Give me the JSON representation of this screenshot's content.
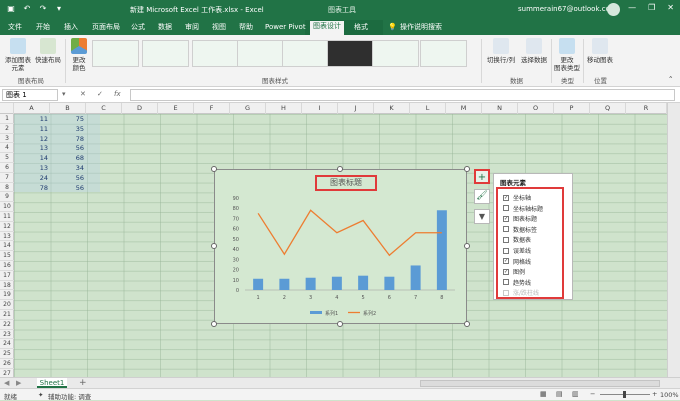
{
  "titlebar": {
    "document_title": "新建 Microsoft Excel 工作表.xlsx - Excel",
    "context_title": "图表工具",
    "account": "summerain67@outlook.com",
    "controls": [
      "—",
      "❐",
      "✕"
    ]
  },
  "tabs": [
    "文件",
    "开始",
    "插入",
    "页面布局",
    "公式",
    "数据",
    "审阅",
    "视图",
    "帮助",
    "Power Pivot",
    "图表设计",
    "格式"
  ],
  "tell_me": "操作说明搜索",
  "ribbon": {
    "groups": {
      "layout": {
        "label": "图表布局",
        "add_element": "添加图表\n元素",
        "quick_layout": "快速布局"
      },
      "styles": {
        "label": "图表样式",
        "change_colors": "更改\n颜色"
      },
      "data": {
        "label": "数据",
        "switch_row_col": "切换行/列",
        "select_data": "选择数据"
      },
      "type": {
        "label": "类型",
        "change_type": "更改\n图表类型"
      },
      "location": {
        "label": "位置",
        "move_chart": "移动图表"
      }
    }
  },
  "formula_bar": {
    "name_box": "图表 1",
    "cancel": "✕",
    "enter": "✓",
    "fx": "fx"
  },
  "columns": [
    "A",
    "B",
    "C",
    "D",
    "E",
    "F",
    "G",
    "H",
    "I",
    "J",
    "K",
    "L",
    "M",
    "N",
    "O",
    "P",
    "Q",
    "R"
  ],
  "rows": [
    "1",
    "2",
    "3",
    "4",
    "5",
    "6",
    "7",
    "8",
    "9",
    "10",
    "11",
    "12",
    "13",
    "14",
    "15",
    "16",
    "17",
    "18",
    "19",
    "20",
    "21",
    "22",
    "23",
    "24",
    "25",
    "26",
    "27"
  ],
  "cells": [
    [
      "11",
      "75"
    ],
    [
      "11",
      "35"
    ],
    [
      "12",
      "78"
    ],
    [
      "13",
      "56"
    ],
    [
      "14",
      "68"
    ],
    [
      "13",
      "34"
    ],
    [
      "24",
      "56"
    ],
    [
      "78",
      "56"
    ]
  ],
  "chart_data": {
    "type": "bar",
    "title": "图表标题",
    "categories": [
      "1",
      "2",
      "3",
      "4",
      "5",
      "6",
      "7",
      "8"
    ],
    "series": [
      {
        "name": "系列1",
        "type": "bar",
        "values": [
          11,
          11,
          12,
          13,
          14,
          13,
          24,
          78
        ],
        "color": "#5b9bd5"
      },
      {
        "name": "系列2",
        "type": "line",
        "values": [
          75,
          35,
          78,
          56,
          68,
          34,
          56,
          56
        ],
        "color": "#ed7d31"
      }
    ],
    "ylim": [
      0,
      90
    ],
    "yticks": [
      "0",
      "10",
      "20",
      "30",
      "40",
      "50",
      "60",
      "70",
      "80",
      "90"
    ],
    "legend": "bottom",
    "grid": false
  },
  "chart_elements": {
    "header": "图表元素",
    "items": [
      {
        "label": "坐标轴",
        "checked": true,
        "enabled": true
      },
      {
        "label": "坐标轴标题",
        "checked": false,
        "enabled": true
      },
      {
        "label": "图表标题",
        "checked": true,
        "enabled": true
      },
      {
        "label": "数据标签",
        "checked": false,
        "enabled": true
      },
      {
        "label": "数据表",
        "checked": false,
        "enabled": true
      },
      {
        "label": "误差线",
        "checked": false,
        "enabled": true
      },
      {
        "label": "网格线",
        "checked": true,
        "enabled": true
      },
      {
        "label": "图例",
        "checked": true,
        "enabled": true
      },
      {
        "label": "趋势线",
        "checked": false,
        "enabled": true
      },
      {
        "label": "涨/跌柱线",
        "checked": false,
        "enabled": false
      }
    ]
  },
  "side_buttons": {
    "add": "+",
    "styles": "🖌",
    "filter": "▼"
  },
  "sheet_tab": "Sheet1",
  "add_sheet": "+",
  "status": {
    "ready": "就绪",
    "accessibility": "辅助功能: 调查"
  },
  "zoom": "100%",
  "colors": {
    "excel_green": "#217346",
    "highlight_red": "#e03a3a"
  }
}
